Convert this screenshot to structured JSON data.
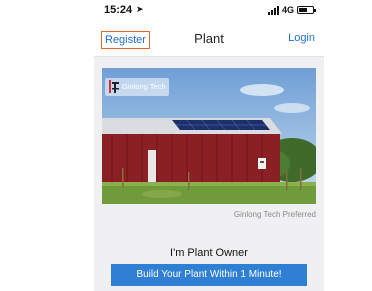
{
  "status_bar": {
    "time": "15:24",
    "network": "4G",
    "location_icon": "location-arrow-icon",
    "signal_icon": "signal-icon",
    "battery_icon": "battery-icon"
  },
  "navbar": {
    "register_label": "Register",
    "title": "Plant",
    "login_label": "Login"
  },
  "banner": {
    "logo_text": "Ginlong Tech",
    "logo_icon": "ginlong-logo-icon"
  },
  "preferred_label": "Ginlong Tech Preferred",
  "owner_heading": "I'm Plant Owner",
  "build_button_label": "Build Your Plant Within 1 Minute!",
  "colors": {
    "link_blue": "#1f6fcf",
    "button_blue": "#2f7fd4",
    "register_highlight": "#e06a2a"
  }
}
